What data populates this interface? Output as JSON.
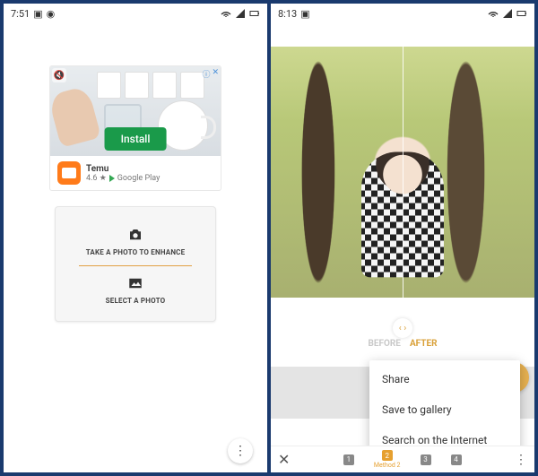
{
  "left": {
    "status": {
      "time": "7:51",
      "battery": ""
    },
    "ad": {
      "corner_info": "ⓘ",
      "corner_close": "✕",
      "install": "Install",
      "app_name": "Temu",
      "rating": "4.6 ★",
      "store": "Google Play"
    },
    "actions": {
      "take": "TAKE A PHOTO TO ENHANCE",
      "select": "SELECT A PHOTO"
    }
  },
  "right": {
    "status": {
      "time": "8:13"
    },
    "before": "BEFORE",
    "after": "AFTER",
    "menu": {
      "share": "Share",
      "save": "Save to gallery",
      "search": "Search on the Internet"
    },
    "steps": {
      "s1": "1",
      "s2": "2",
      "s3": "3",
      "s4": "4",
      "label2": "Method 2"
    }
  }
}
